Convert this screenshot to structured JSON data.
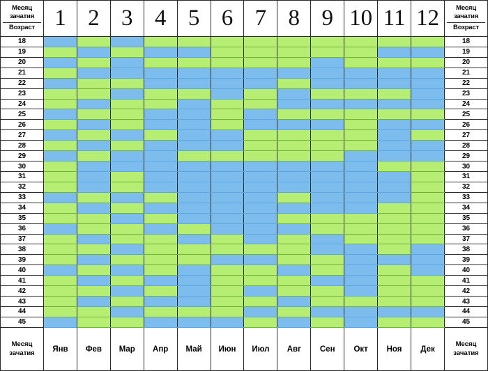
{
  "table": {
    "corner_top_left": {
      "line1": "Месяц",
      "line2": "зачатия",
      "line3": "Возраст"
    },
    "corner_top_right": {
      "line1": "Месяц",
      "line2": "зачатия",
      "line3": "Возраст"
    },
    "corner_bottom_left": {
      "line1": "Месяц",
      "line2": "зачатия"
    },
    "corner_bottom_right": {
      "line1": "Месяц",
      "line2": "зачатия"
    },
    "month_numbers": [
      "1",
      "2",
      "3",
      "4",
      "5",
      "6",
      "7",
      "8",
      "9",
      "10",
      "11",
      "12"
    ],
    "month_names": [
      "Янв",
      "Фев",
      "Мар",
      "Апр",
      "Май",
      "Июн",
      "Июл",
      "Авг",
      "Сен",
      "Окт",
      "Ноя",
      "Дек"
    ],
    "ages": [
      18,
      19,
      20,
      21,
      22,
      23,
      24,
      25,
      26,
      27,
      28,
      29,
      30,
      31,
      32,
      33,
      34,
      35,
      36,
      37,
      38,
      39,
      40,
      41,
      42,
      43,
      44,
      45
    ]
  },
  "colors": {
    "blue": "#7dbdee",
    "green": "#b6ee74",
    "grid": "#2b2b2b",
    "background": "#ffffff"
  },
  "chart_data": {
    "type": "heatmap",
    "title": "",
    "xlabel": "Месяц зачатия",
    "ylabel": "Возраст",
    "categories": [
      "1",
      "2",
      "3",
      "4",
      "5",
      "6",
      "7",
      "8",
      "9",
      "10",
      "11",
      "12"
    ],
    "rows": [
      18,
      19,
      20,
      21,
      22,
      23,
      24,
      25,
      26,
      27,
      28,
      29,
      30,
      31,
      32,
      33,
      34,
      35,
      36,
      37,
      38,
      39,
      40,
      41,
      42,
      43,
      44,
      45
    ],
    "legend": [
      {
        "key": "b",
        "color": "#7dbdee"
      },
      {
        "key": "g",
        "color": "#b6ee74"
      }
    ],
    "grid": true,
    "values": [
      [
        "b",
        "g",
        "b",
        "g",
        "g",
        "g",
        "g",
        "g",
        "g",
        "g",
        "g",
        "g"
      ],
      [
        "g",
        "b",
        "g",
        "b",
        "b",
        "g",
        "g",
        "g",
        "g",
        "g",
        "b",
        "b"
      ],
      [
        "b",
        "g",
        "b",
        "g",
        "g",
        "g",
        "g",
        "g",
        "b",
        "g",
        "g",
        "g"
      ],
      [
        "g",
        "b",
        "b",
        "b",
        "b",
        "b",
        "b",
        "b",
        "b",
        "b",
        "b",
        "b"
      ],
      [
        "b",
        "g",
        "g",
        "b",
        "b",
        "b",
        "b",
        "g",
        "b",
        "b",
        "b",
        "b"
      ],
      [
        "g",
        "g",
        "b",
        "g",
        "g",
        "b",
        "g",
        "b",
        "g",
        "g",
        "g",
        "b"
      ],
      [
        "g",
        "b",
        "g",
        "g",
        "b",
        "g",
        "g",
        "b",
        "b",
        "b",
        "b",
        "b"
      ],
      [
        "b",
        "g",
        "g",
        "b",
        "b",
        "g",
        "b",
        "g",
        "g",
        "g",
        "g",
        "g"
      ],
      [
        "g",
        "b",
        "g",
        "b",
        "b",
        "g",
        "b",
        "b",
        "b",
        "g",
        "b",
        "b"
      ],
      [
        "b",
        "g",
        "b",
        "g",
        "b",
        "b",
        "g",
        "g",
        "g",
        "g",
        "b",
        "g"
      ],
      [
        "g",
        "b",
        "g",
        "b",
        "b",
        "b",
        "g",
        "g",
        "g",
        "g",
        "b",
        "b"
      ],
      [
        "b",
        "g",
        "b",
        "b",
        "g",
        "g",
        "g",
        "g",
        "g",
        "b",
        "b",
        "b"
      ],
      [
        "g",
        "b",
        "b",
        "b",
        "b",
        "b",
        "b",
        "b",
        "b",
        "b",
        "g",
        "g"
      ],
      [
        "g",
        "b",
        "g",
        "b",
        "b",
        "b",
        "b",
        "b",
        "b",
        "b",
        "b",
        "g"
      ],
      [
        "g",
        "b",
        "g",
        "b",
        "b",
        "b",
        "b",
        "b",
        "b",
        "b",
        "b",
        "g"
      ],
      [
        "b",
        "g",
        "b",
        "g",
        "b",
        "b",
        "b",
        "g",
        "b",
        "b",
        "b",
        "g"
      ],
      [
        "g",
        "b",
        "g",
        "b",
        "b",
        "b",
        "b",
        "b",
        "b",
        "b",
        "g",
        "g"
      ],
      [
        "g",
        "g",
        "b",
        "g",
        "b",
        "b",
        "b",
        "g",
        "g",
        "g",
        "g",
        "g"
      ],
      [
        "b",
        "g",
        "g",
        "b",
        "g",
        "b",
        "b",
        "b",
        "g",
        "g",
        "g",
        "g"
      ],
      [
        "g",
        "b",
        "g",
        "g",
        "b",
        "g",
        "b",
        "g",
        "b",
        "g",
        "g",
        "g"
      ],
      [
        "g",
        "g",
        "b",
        "g",
        "g",
        "g",
        "g",
        "g",
        "b",
        "b",
        "g",
        "b"
      ],
      [
        "g",
        "b",
        "g",
        "g",
        "g",
        "b",
        "b",
        "g",
        "g",
        "b",
        "b",
        "b"
      ],
      [
        "b",
        "g",
        "b",
        "g",
        "b",
        "g",
        "g",
        "b",
        "g",
        "b",
        "g",
        "b"
      ],
      [
        "g",
        "b",
        "g",
        "b",
        "b",
        "g",
        "g",
        "g",
        "b",
        "b",
        "g",
        "g"
      ],
      [
        "g",
        "g",
        "b",
        "g",
        "b",
        "g",
        "b",
        "g",
        "g",
        "b",
        "g",
        "g"
      ],
      [
        "g",
        "b",
        "g",
        "b",
        "b",
        "g",
        "g",
        "b",
        "g",
        "g",
        "g",
        "g"
      ],
      [
        "g",
        "g",
        "b",
        "g",
        "g",
        "g",
        "b",
        "g",
        "b",
        "b",
        "b",
        "b"
      ],
      [
        "b",
        "g",
        "g",
        "b",
        "b",
        "b",
        "g",
        "b",
        "g",
        "b",
        "g",
        "g"
      ]
    ]
  }
}
